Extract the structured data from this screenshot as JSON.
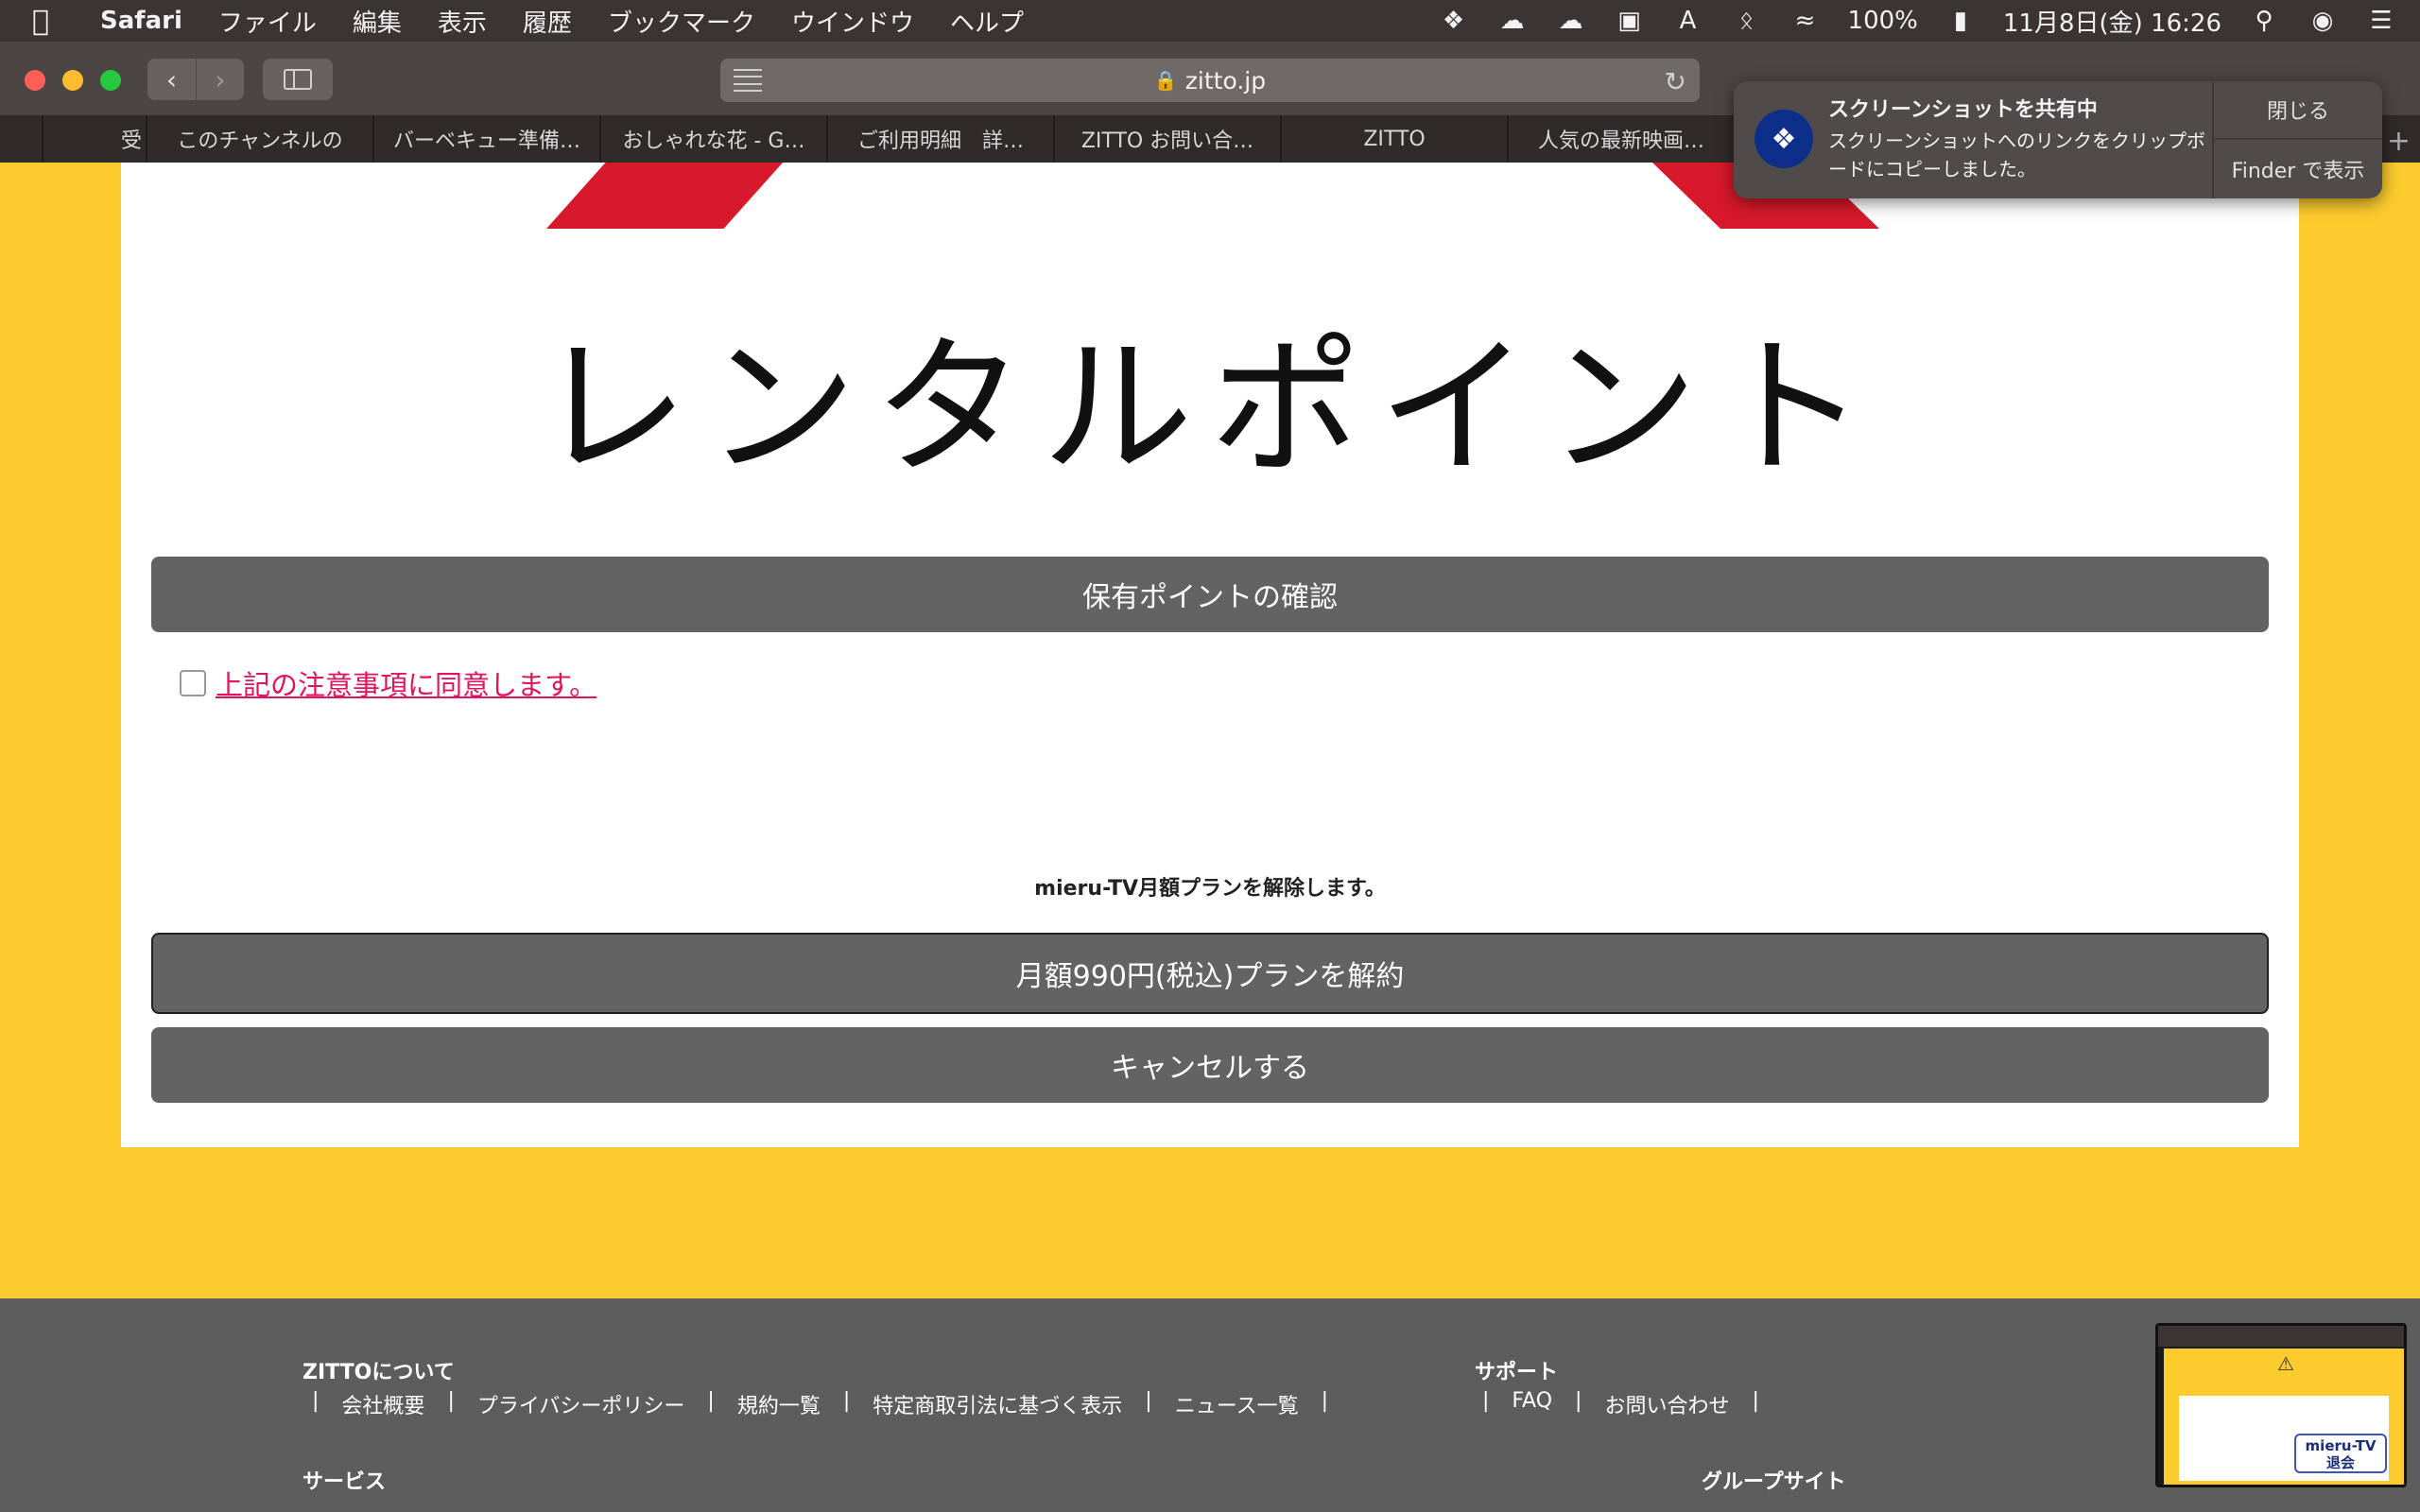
{
  "menubar": {
    "apple_icon": "apple-icon",
    "app_name": "Safari",
    "items": [
      "ファイル",
      "編集",
      "表示",
      "履歴",
      "ブックマーク",
      "ウインドウ",
      "ヘルプ"
    ],
    "battery": "100%",
    "datetime": "11月8日(金)  16:26",
    "input_indicator": "A"
  },
  "toolbar": {
    "url": "zitto.jp"
  },
  "tabs": [
    "",
    "受",
    "このチャンネルの",
    "バーベキュー準備…",
    "おしゃれな花 - G…",
    "ご利用明細　詳…",
    "ZITTO お問い合…",
    "ZITTO",
    "人気の最新映画…"
  ],
  "notification": {
    "title": "スクリーンショットを共有中",
    "body": "スクリーンショットへのリンクをクリップボードにコピーしました。",
    "close_label": "閉じる",
    "finder_label": "Finder で表示"
  },
  "page": {
    "hero_title": "レンタルポイント",
    "points_button": "保有ポイントの確認",
    "agree_label": "上記の注意事項に同意します。",
    "plan_note": "mieru-TV月額プランを解除します。",
    "cancel_plan_button": "月額990円(税込)プランを解約",
    "cancel_button": "キャンセルする"
  },
  "footer": {
    "about_title": "ZITTOについて",
    "about_links": [
      "会社概要",
      "プライバシーポリシー",
      "規約一覧",
      "特定商取引法に基づく表示",
      "ニュース一覧"
    ],
    "support_title": "サポート",
    "support_links": [
      "FAQ",
      "お問い合わせ"
    ],
    "service_title": "サービス",
    "group_title": "グループサイト"
  },
  "thumbnail": {
    "badge_line1": "mieru-TV",
    "badge_line2": "退会"
  },
  "colors": {
    "page_background": "#fccb2d",
    "button_gray": "#636363",
    "agree_link": "#e0135d",
    "accent_red": "#d7192b",
    "footer_gray": "#5d5d5d"
  }
}
